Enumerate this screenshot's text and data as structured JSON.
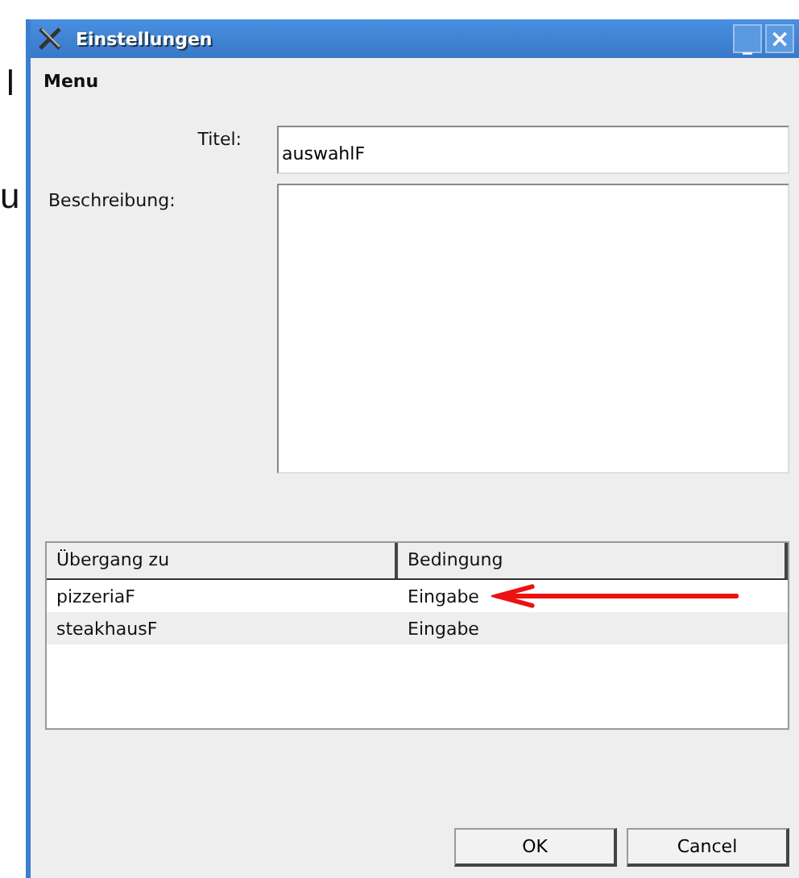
{
  "background_text": [
    "l",
    "u"
  ],
  "window": {
    "title": "Einstellungen",
    "controls": [
      {
        "kind": "minimize",
        "label": "_"
      },
      {
        "kind": "close",
        "label": "×"
      }
    ]
  },
  "section": "Menu",
  "fields": [
    {
      "kind": "line",
      "label": "Titel:",
      "value": "auswahlF"
    },
    {
      "kind": "area",
      "label": "Beschreibung:"
    }
  ],
  "table": {
    "columns": [
      "Übergang zu",
      "Bedingung"
    ],
    "rows": [
      {
        "cells": [
          "pizzeriaF",
          "Eingabe"
        ],
        "annotated": true
      },
      {
        "cells": [
          "steakhausF",
          "Eingabe"
        ],
        "annotated": false
      }
    ]
  },
  "buttons": [
    "OK",
    "Cancel"
  ]
}
